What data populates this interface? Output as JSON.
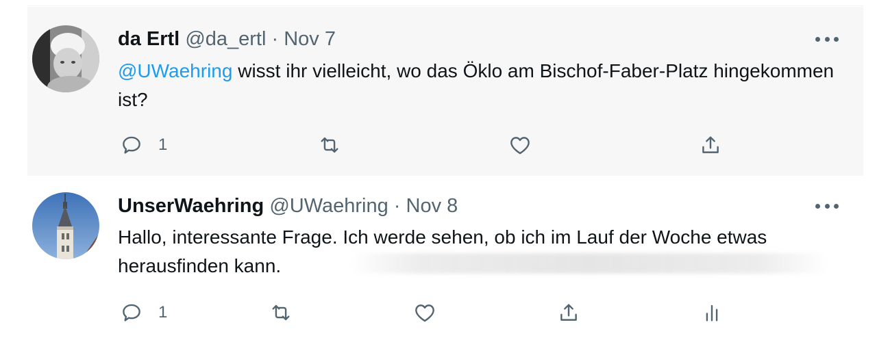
{
  "tweets": [
    {
      "name": "da Ertl",
      "handle": "@da_ertl",
      "separator": "·",
      "date": "Nov 7",
      "mention": "@UWaehring",
      "text_after_mention": " wisst ihr vielleicht, wo das Öklo am Bischof-Faber-Platz hingekommen ist?",
      "reply_count": "1",
      "icons": [
        "reply-icon",
        "retweet-icon",
        "like-icon",
        "share-icon",
        "more-icon"
      ]
    },
    {
      "name": "UnserWaehring",
      "handle": "@UWaehring",
      "separator": "·",
      "date": "Nov 8",
      "text": "Hallo, interessante Frage. Ich werde sehen, ob ich im Lauf der Woche etwas herausfinden kann.",
      "reply_count": "1",
      "icons": [
        "reply-icon",
        "retweet-icon",
        "like-icon",
        "share-icon",
        "analytics-icon",
        "more-icon"
      ]
    }
  ],
  "colors": {
    "mention": "#1d9bf0",
    "secondary_text": "#536471",
    "primary_text": "#0f1419",
    "highlight_background": "#f7f7f7",
    "thread_line": "#cfd9de"
  }
}
